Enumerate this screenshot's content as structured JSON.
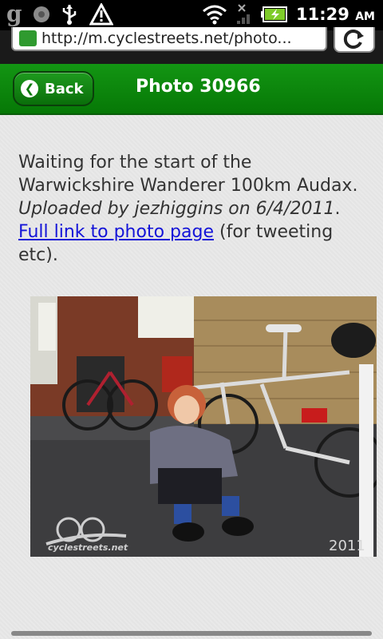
{
  "status_bar": {
    "time": "11:29",
    "ampm": "AM",
    "icons": [
      "google-g-icon",
      "circle-icon",
      "usb-icon",
      "warning-icon",
      "wifi-icon",
      "signal-x-icon",
      "battery-charging-icon"
    ]
  },
  "browser": {
    "url": "http://m.cyclestreets.net/photo...",
    "refresh_icon": "refresh-icon"
  },
  "header": {
    "back_label": "Back",
    "title": "Photo 30966",
    "accent": "#0a7d0a"
  },
  "content": {
    "caption": "Waiting for the start of the Warwickshire Wanderer 100km Audax.",
    "uploaded": "Uploaded by jezhiggins on 6/4/2011",
    "uploaded_end": ".",
    "link_text": "Full link to photo page",
    "link_suffix": " (for tweeting etc).",
    "photo": {
      "watermark": "cyclestreets.net",
      "year": "2011"
    }
  }
}
